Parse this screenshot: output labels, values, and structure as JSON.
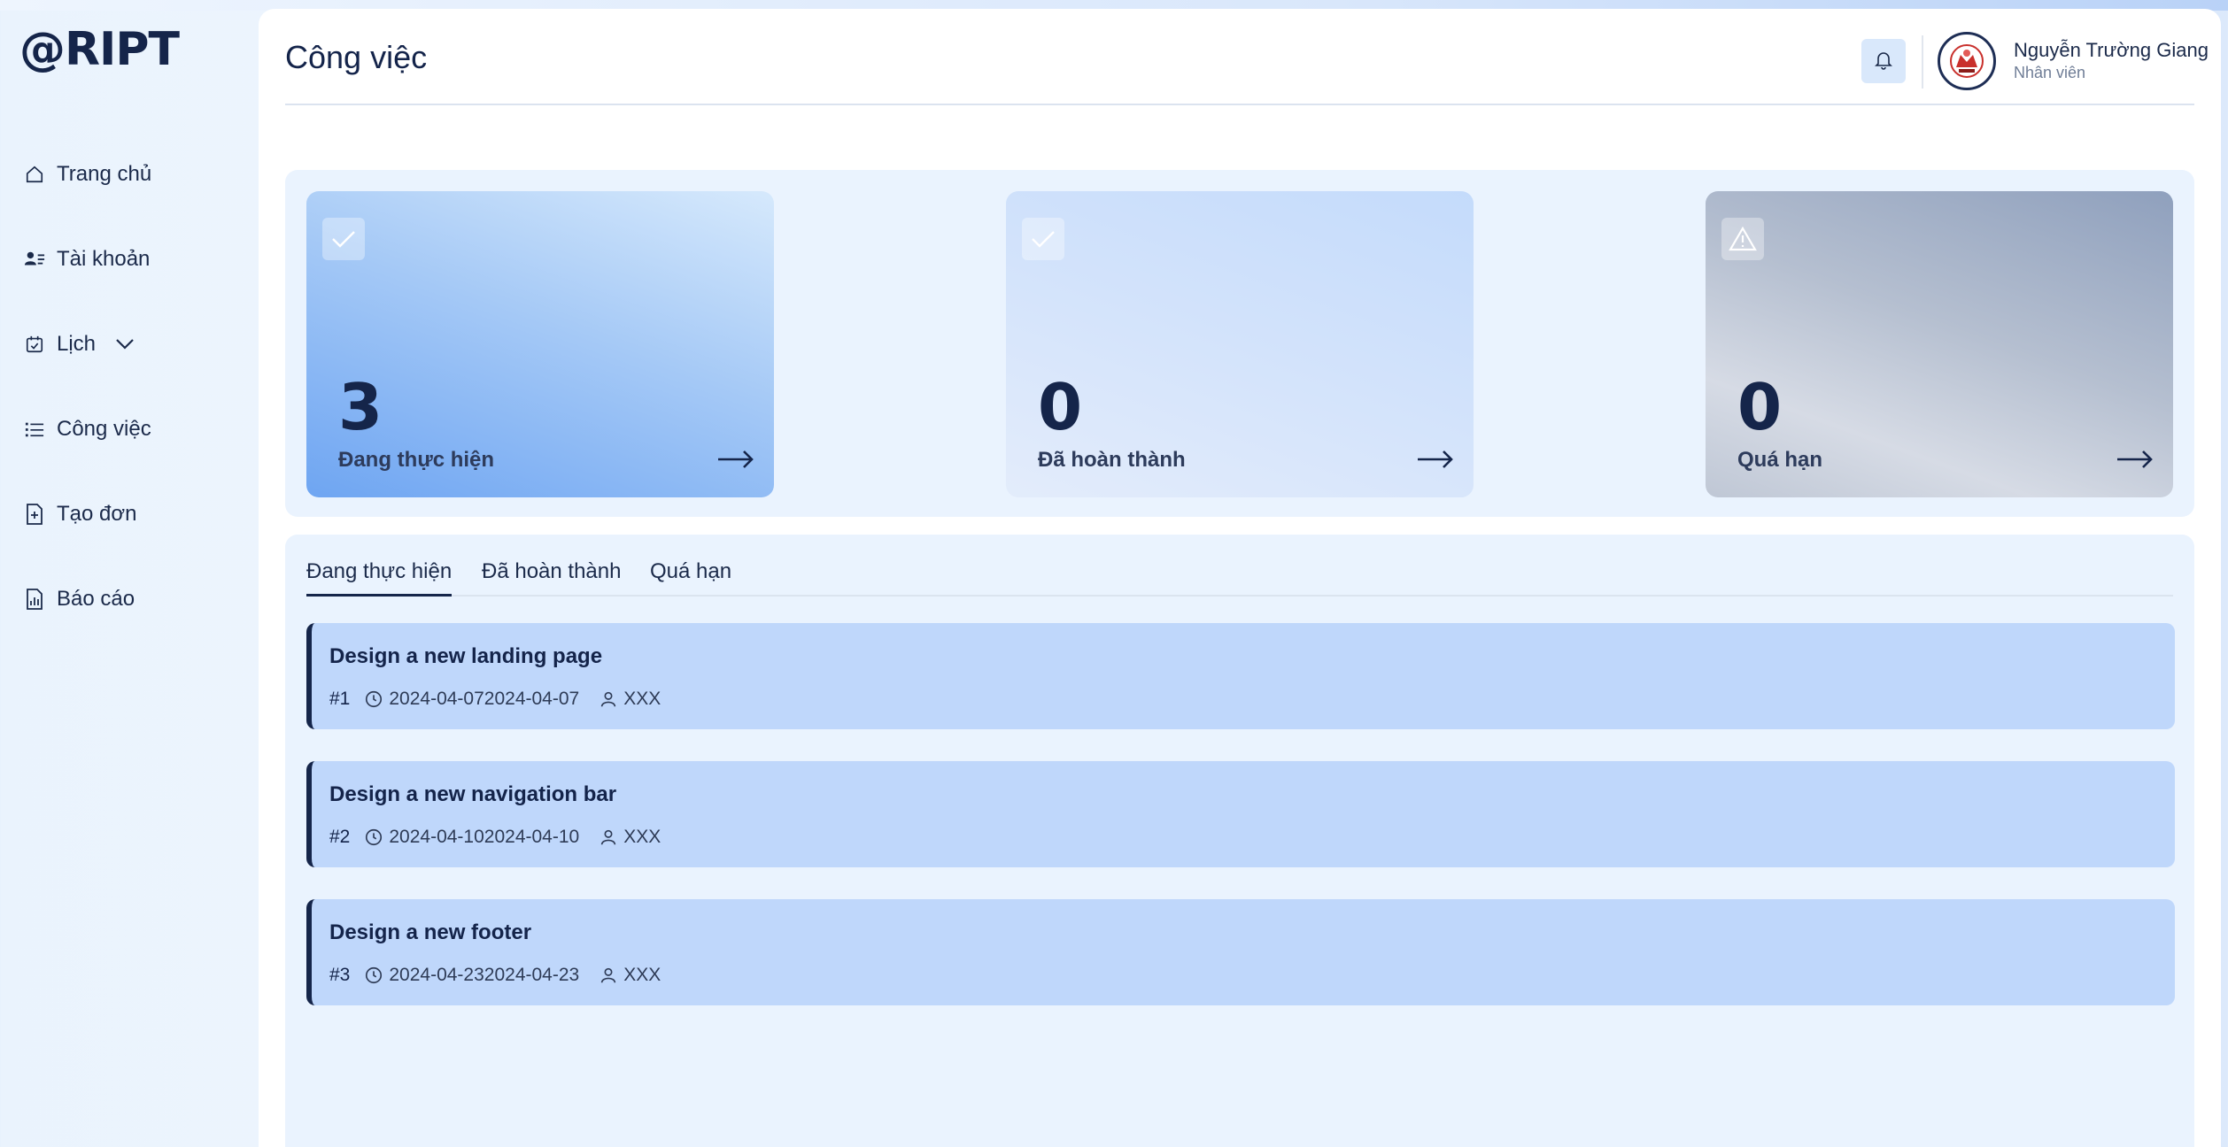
{
  "app": {
    "logo": "@RIPT"
  },
  "sidebar": {
    "items": [
      {
        "label": "Trang chủ",
        "icon": "home-icon"
      },
      {
        "label": "Tài khoản",
        "icon": "user-card-icon"
      },
      {
        "label": "Lịch",
        "icon": "calendar-check-icon",
        "has_dropdown": true
      },
      {
        "label": "Công việc",
        "icon": "list-icon"
      },
      {
        "label": "Tạo đơn",
        "icon": "file-plus-icon"
      },
      {
        "label": "Báo cáo",
        "icon": "report-icon"
      }
    ]
  },
  "header": {
    "title": "Công việc",
    "user_name": "Nguyễn Trường Giang",
    "user_role": "Nhân viên"
  },
  "stats": [
    {
      "value": "3",
      "label": "Đang thực hiện",
      "icon": "check-icon"
    },
    {
      "value": "0",
      "label": "Đã hoàn thành",
      "icon": "check-icon"
    },
    {
      "value": "0",
      "label": "Quá hạn",
      "icon": "warning-icon"
    }
  ],
  "tabs": [
    {
      "label": "Đang thực hiện",
      "active": true
    },
    {
      "label": "Đã hoàn thành",
      "active": false
    },
    {
      "label": "Quá hạn",
      "active": false
    }
  ],
  "tasks": [
    {
      "title": "Design a new landing page",
      "id": "#1",
      "date": "2024-04-072024-04-07",
      "assignee": "XXX"
    },
    {
      "title": "Design a new navigation bar",
      "id": "#2",
      "date": "2024-04-102024-04-10",
      "assignee": "XXX"
    },
    {
      "title": "Design a new footer",
      "id": "#3",
      "date": "2024-04-232024-04-23",
      "assignee": "XXX"
    }
  ],
  "colors": {
    "primary": "#15254a",
    "task_bg": "#bfd7fb",
    "panel_bg": "#eaf3fe"
  }
}
